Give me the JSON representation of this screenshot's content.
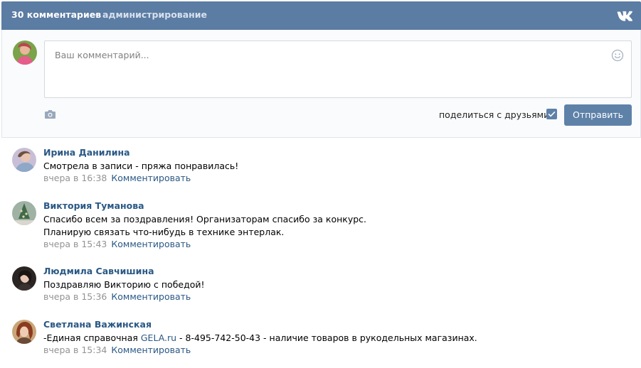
{
  "header": {
    "count_label": "30 комментариев",
    "separator": "·",
    "admin_label": "администрирование",
    "bg_color": "#5b7ca3",
    "logo_icon": "vk-logo-icon"
  },
  "composer": {
    "placeholder": "Ваш комментарий...",
    "share_label": "поделиться с друзьями",
    "share_checked": true,
    "send_label": "Отправить",
    "accent_color": "#5e81a8"
  },
  "comments": [
    {
      "author": "Ирина Данилина",
      "text": "Смотрела в записи - пряжа понравилась!",
      "time": "вчера в 16:38",
      "reply_label": "Комментировать"
    },
    {
      "author": "Виктория Туманова",
      "text": "Спасибо всем за поздравления! Организаторам спасибо за конкурс.",
      "text2": "Планирую связать что-нибудь в технике энтерлак.",
      "time": "вчера в 15:43",
      "reply_label": "Комментировать"
    },
    {
      "author": "Людмила Савчишина",
      "text": "Поздравляю Викторию с победой!",
      "time": "вчера в 15:36",
      "reply_label": "Комментировать"
    },
    {
      "author": "Светлана Важинская",
      "text_before": "-Единая справочная ",
      "link": "GELA.ru",
      "text_after": " - 8-495-742-50-43 - наличие товаров в рукодельных магазинах.",
      "time": "вчера в 15:34",
      "reply_label": "Комментировать"
    }
  ]
}
